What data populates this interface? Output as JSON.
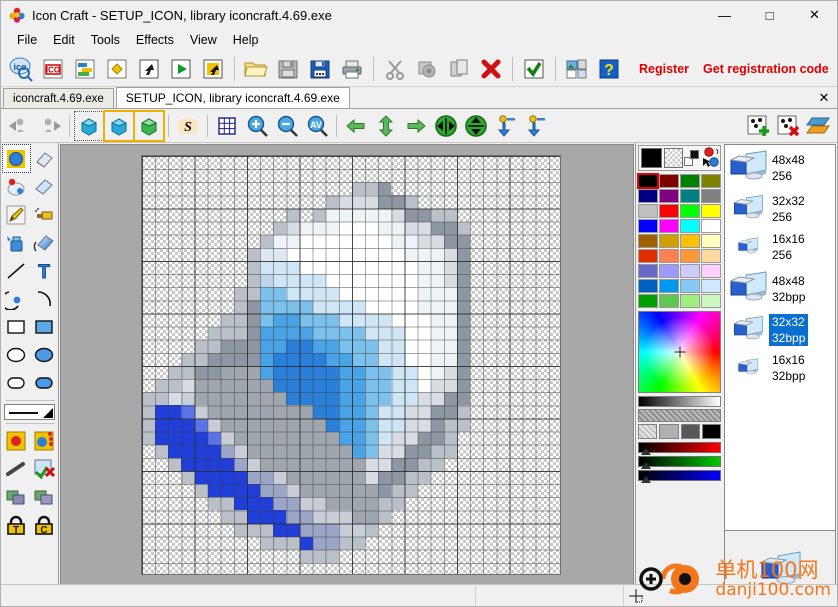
{
  "window": {
    "title": "Icon Craft - SETUP_ICON, library iconcraft.4.69.exe",
    "app_icon": "icon-craft-logo-icon",
    "minimize": "—",
    "maximize": "□",
    "close": "✕"
  },
  "menubar": {
    "items": [
      {
        "label": "File"
      },
      {
        "label": "Edit"
      },
      {
        "label": "Tools"
      },
      {
        "label": "Effects"
      },
      {
        "label": "View"
      },
      {
        "label": "Help"
      }
    ]
  },
  "toolbar_main": {
    "buttons": [
      {
        "name": "browse-icons-icon",
        "glyph": "ico-search"
      },
      {
        "name": "new-icon-icon",
        "glyph": "ico-red"
      },
      {
        "name": "new-image-icon",
        "glyph": "layers-color"
      },
      {
        "name": "new-cursor-icon",
        "glyph": "yellow-diamond"
      },
      {
        "name": "extract-icon-icon",
        "glyph": "arrow-box"
      },
      {
        "name": "play-animation-icon",
        "glyph": "green-play"
      },
      {
        "name": "import-icon",
        "glyph": "yellow-arrow-box"
      },
      {
        "name": "open-icon",
        "glyph": "folder-open"
      },
      {
        "name": "save-icon",
        "glyph": "floppy-gray"
      },
      {
        "name": "save-all-icon",
        "glyph": "floppy-blue"
      },
      {
        "name": "print-icon",
        "glyph": "printer"
      },
      {
        "name": "cut-icon",
        "glyph": "scissors"
      },
      {
        "name": "copy-icon",
        "glyph": "copy-gray"
      },
      {
        "name": "paste-icon",
        "glyph": "paste"
      },
      {
        "name": "delete-icon",
        "glyph": "red-x"
      },
      {
        "name": "apply-icon",
        "glyph": "green-check"
      },
      {
        "name": "image-library-icon",
        "glyph": "photo-list"
      },
      {
        "name": "help-icon",
        "glyph": "blue-question"
      }
    ],
    "register_label": "Register",
    "get_code_label": "Get registration code",
    "alert_label": "!"
  },
  "tabs": {
    "items": [
      {
        "label": "iconcraft.4.69.exe",
        "active": false
      },
      {
        "label": "SETUP_ICON, library iconcraft.4.69.exe",
        "active": true
      }
    ],
    "close_label": "✕"
  },
  "toolbar_edit": {
    "buttons": [
      {
        "name": "undo-icon",
        "glyph": "undo"
      },
      {
        "name": "redo-icon",
        "glyph": "redo"
      },
      {
        "name": "select-image-icon",
        "glyph": "cube-plain"
      },
      {
        "name": "select-image-yellow-icon",
        "glyph": "cube-yellow"
      },
      {
        "name": "select-image-green-icon",
        "glyph": "cube-green"
      },
      {
        "name": "smooth-icon",
        "glyph": "s-letter"
      },
      {
        "name": "toggle-grid-icon",
        "glyph": "grid"
      },
      {
        "name": "zoom-in-icon",
        "glyph": "zoom-plus"
      },
      {
        "name": "zoom-out-icon",
        "glyph": "zoom-minus"
      },
      {
        "name": "zoom-actual-icon",
        "glyph": "zoom-av"
      },
      {
        "name": "rotate-left-icon",
        "glyph": "arrow-left-green"
      },
      {
        "name": "rotate-updown-icon",
        "glyph": "arrow-updown-green"
      },
      {
        "name": "rotate-right-icon",
        "glyph": "arrow-right-green"
      },
      {
        "name": "flip-horizontal-icon",
        "glyph": "flip-h"
      },
      {
        "name": "flip-vertical-icon",
        "glyph": "flip-v"
      },
      {
        "name": "shift-down-1-icon",
        "glyph": "pin-down-1"
      },
      {
        "name": "shift-down-2-icon",
        "glyph": "pin-down-2"
      }
    ],
    "right_buttons": [
      {
        "name": "add-image-icon",
        "glyph": "add-image"
      },
      {
        "name": "delete-image-icon",
        "glyph": "delete-image"
      },
      {
        "name": "layers-icon",
        "glyph": "layers-orange"
      }
    ]
  },
  "tool_palette": {
    "tools": [
      {
        "name": "select-ellipse-tool",
        "glyph": "blue-circle-yellow",
        "selected": true
      },
      {
        "name": "eraser-tool",
        "glyph": "eraser-pink"
      },
      {
        "name": "color-picker-tool",
        "glyph": "dropper-balls"
      },
      {
        "name": "eraser-block-tool",
        "glyph": "eraser-blue"
      },
      {
        "name": "pencil-tool",
        "glyph": "pencil"
      },
      {
        "name": "airbrush-tool",
        "glyph": "spray"
      },
      {
        "name": "fill-bucket-tool",
        "glyph": "bucket"
      },
      {
        "name": "gradient-tool",
        "glyph": "gradient"
      },
      {
        "name": "line-tool",
        "glyph": "line"
      },
      {
        "name": "text-tool",
        "glyph": "text-t"
      },
      {
        "name": "curve-filled-tool",
        "glyph": "curve-ball"
      },
      {
        "name": "curve-tool",
        "glyph": "arc"
      },
      {
        "name": "rectangle-outline-tool",
        "glyph": "rect-outline"
      },
      {
        "name": "rectangle-filled-tool",
        "glyph": "rect-filled"
      },
      {
        "name": "ellipse-outline-tool",
        "glyph": "ellipse-outline"
      },
      {
        "name": "ellipse-filled-tool",
        "glyph": "ellipse-filled"
      },
      {
        "name": "roundrect-outline-tool",
        "glyph": "roundrect-outline"
      },
      {
        "name": "roundrect-filled-tool",
        "glyph": "roundrect-filled"
      }
    ],
    "line_width_selector": "line-width-dropdown",
    "extra_tools": [
      {
        "name": "foreground-color-tool",
        "glyph": "red-ball-yellow"
      },
      {
        "name": "palette-color-tool",
        "glyph": "blue-ball-beads"
      },
      {
        "name": "brush-stroke-tool",
        "glyph": "brush-stroke"
      },
      {
        "name": "clear-transparency-tool",
        "glyph": "blue-check-x"
      },
      {
        "name": "opaque-layers-tool",
        "glyph": "green-layers"
      },
      {
        "name": "transparent-layers-tool",
        "glyph": "gray-layers"
      },
      {
        "name": "lock-transparency-tool",
        "glyph": "lock-t"
      },
      {
        "name": "lock-color-tool",
        "glyph": "lock-c"
      }
    ]
  },
  "color_panel": {
    "foreground": "#000000",
    "background": "transparent",
    "picker_icons": [
      "red-ball-icon",
      "blue-ball-icon",
      "arrow-picker-icon"
    ],
    "selected_swatch_index": 0,
    "swatches": [
      "#000000",
      "#800000",
      "#008000",
      "#808000",
      "#000080",
      "#800080",
      "#008080",
      "#808080",
      "#c0c0c0",
      "#ff0000",
      "#00ff00",
      "#ffff00",
      "#0000ff",
      "#ff00ff",
      "#00ffff",
      "#ffffff",
      "#a06000",
      "#d0a000",
      "#ffc000",
      "#ffffc0",
      "#e03000",
      "#ff8050",
      "#ff9838",
      "#ffd9a0",
      "#6868c8",
      "#9a9aff",
      "#ccccff",
      "#ffd0ff",
      "#0060c0",
      "#0098f0",
      "#88c8f8",
      "#d0e8ff",
      "#00a000",
      "#60c850",
      "#a0ee80",
      "#ccf8c0"
    ],
    "alpha_cells": [
      "transparent",
      "#b0b0b0",
      "#585858",
      "#000000"
    ],
    "rgb_sliders": [
      {
        "name": "red-slider",
        "from": "#000000",
        "to": "#ff0000"
      },
      {
        "name": "green-slider",
        "from": "#000000",
        "to": "#00c800"
      },
      {
        "name": "blue-slider",
        "from": "#000000",
        "to": "#0000ff"
      }
    ]
  },
  "image_list": {
    "items": [
      {
        "size": "48x48",
        "depth": "256",
        "icon": "computer-icon-large",
        "selected": false
      },
      {
        "size": "32x32",
        "depth": "256",
        "icon": "computer-icon-medium",
        "selected": false
      },
      {
        "size": "16x16",
        "depth": "256",
        "icon": "computer-icon-small",
        "selected": false
      },
      {
        "size": "48x48",
        "depth": "32bpp",
        "icon": "computer-icon-large",
        "selected": false
      },
      {
        "size": "32x32",
        "depth": "32bpp",
        "icon": "computer-icon-medium",
        "selected": true
      },
      {
        "size": "16x16",
        "depth": "32bpp",
        "icon": "computer-icon-small",
        "selected": false
      }
    ],
    "preview_icon": "computer-icon-preview"
  },
  "canvas": {
    "grid_size": 32,
    "zoom_cursor": "crosshair-select-icon"
  },
  "watermark": {
    "text_cn": "单机100网",
    "text_en": "danji100.com",
    "color_cn": "#f4761b",
    "color_en": "#f4761b",
    "logo": "danji-logo-icon"
  },
  "statusbar": {
    "pane1": "",
    "pane2": "",
    "cursor_icon": "crosshair-icon"
  }
}
